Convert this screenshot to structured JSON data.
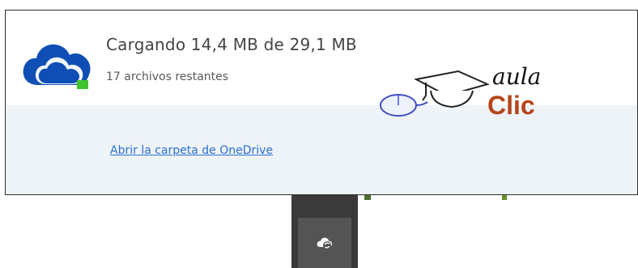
{
  "status": {
    "title": "Cargando 14,4 MB de 29,1 MB",
    "subtitle": "17 archivos restantes",
    "indicator_color": "#3ec22e"
  },
  "actions": {
    "open_folder_link": "Abrir la carpeta de OneDrive"
  },
  "branding": {
    "aula": "aula",
    "clic": "Clic"
  },
  "icons": {
    "app": "onedrive-cloud-icon",
    "tray": "onedrive-sync-icon"
  },
  "colors": {
    "cloud_blue": "#0f4fb5",
    "link": "#2a6fcf",
    "clic": "#b5451a"
  }
}
